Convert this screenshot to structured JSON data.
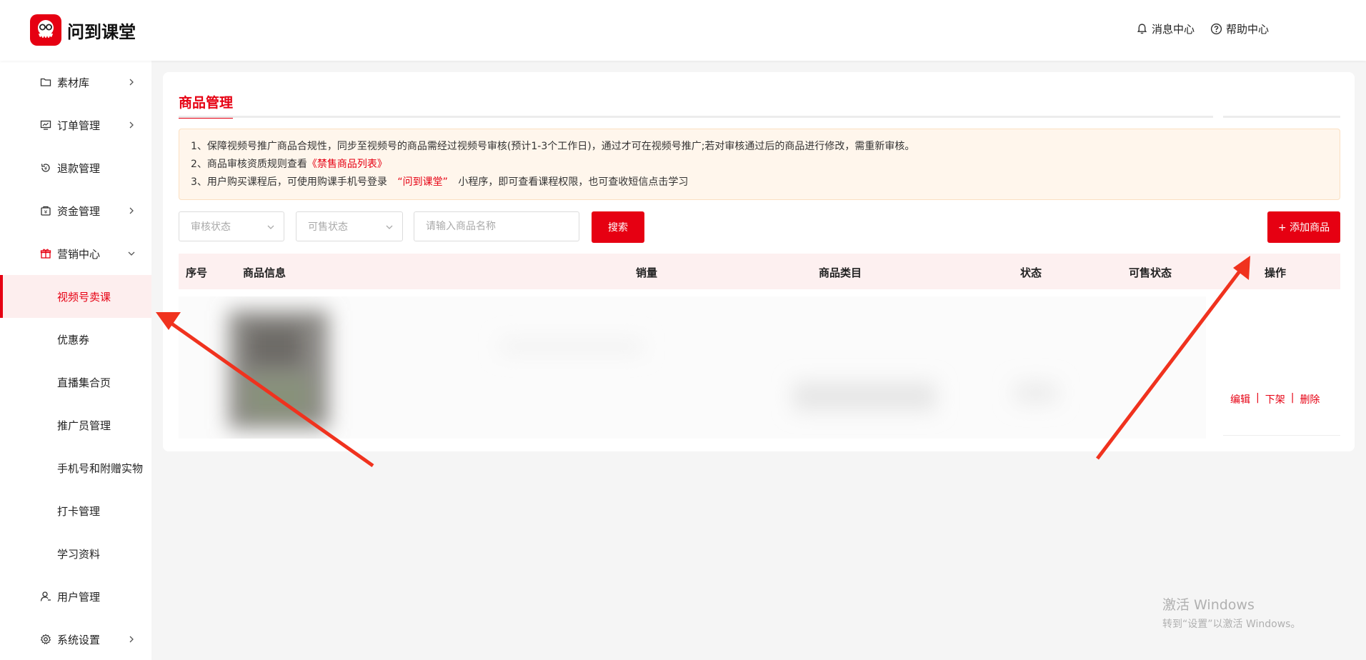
{
  "app": {
    "brand_name": "问到课堂",
    "brand_color": "#e60012"
  },
  "header": {
    "messages_label": "消息中心",
    "help_label": "帮助中心"
  },
  "sidebar": {
    "items": [
      {
        "label": "素材库",
        "icon": "folder-icon",
        "chevron": "right"
      },
      {
        "label": "订单管理",
        "icon": "monitor-icon",
        "chevron": "right"
      },
      {
        "label": "退款管理",
        "icon": "refund-icon"
      },
      {
        "label": "资金管理",
        "icon": "wallet-icon",
        "chevron": "right"
      },
      {
        "label": "营销中心",
        "icon": "gift-icon",
        "chevron": "down",
        "expanded": true
      }
    ],
    "sub_items": [
      "视频号卖课",
      "优惠券",
      "直播集合页",
      "推广员管理",
      "手机号和附赠实物",
      "打卡管理",
      "学习资料"
    ],
    "active_sub": "视频号卖课",
    "bottom_items": [
      {
        "label": "用户管理",
        "icon": "user-icon"
      },
      {
        "label": "系统设置",
        "icon": "gear-icon",
        "chevron": "right"
      }
    ]
  },
  "main": {
    "tab_title": "商品管理",
    "notice": {
      "line1": "1、保障视频号推广商品合规性，同步至视频号的商品需经过视频号审核(预计1-3个工作日)，通过才可在视频号推广;若对审核通过后的商品进行修改，需重新审核。",
      "line2_prefix": "2、商品审核资质规则查看",
      "line2_link": "《禁售商品列表》",
      "line3_prefix": "3、用户购买课程后，可使用购课手机号登录",
      "line3_highlight": "“问到课堂”",
      "line3_suffix": "小程序，即可查看课程权限，也可查收短信点击学习"
    },
    "filters": {
      "audit_status_placeholder": "审核状态",
      "sale_status_placeholder": "可售状态",
      "name_placeholder": "请输入商品名称",
      "search_label": "搜索",
      "add_label": "+ 添加商品"
    },
    "table": {
      "columns": [
        "序号",
        "商品信息",
        "销量",
        "商品类目",
        "状态",
        "可售状态",
        "操作"
      ],
      "row_actions": [
        "编辑",
        "下架",
        "删除"
      ]
    }
  },
  "watermark": {
    "line1": "激活 Windows",
    "line2": "转到“设置”以激活 Windows。"
  }
}
